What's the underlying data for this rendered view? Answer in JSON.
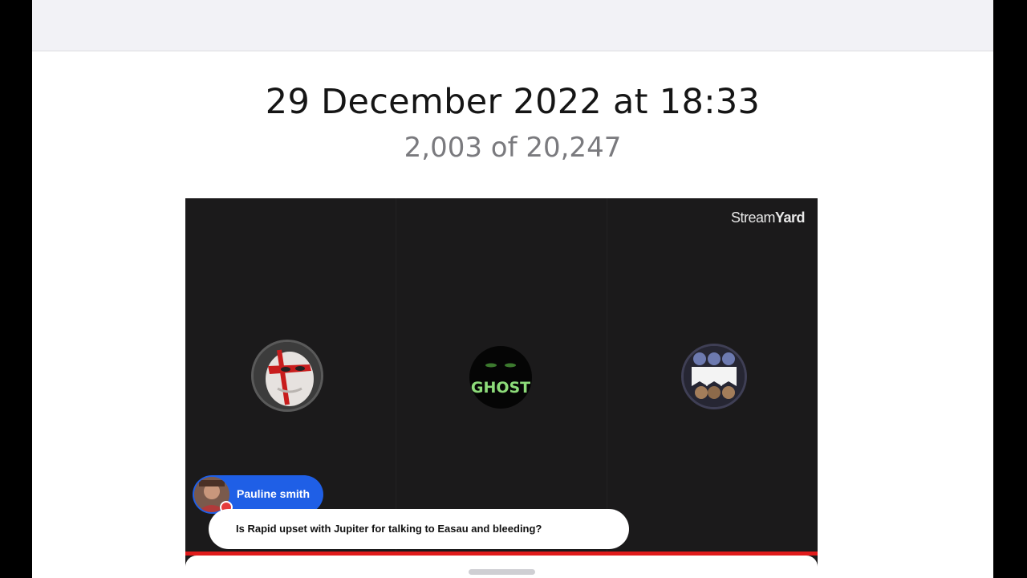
{
  "header": {
    "date": "29 December 2022 at 18:33",
    "counter": "2,003 of 20,247"
  },
  "video": {
    "watermark_light": "Stream",
    "watermark_bold": "Yard",
    "participants": [
      {
        "name": "masked-avatar-icon"
      },
      {
        "name": "ghost",
        "label": "GHOST"
      },
      {
        "name": "group-avatar-icon"
      }
    ],
    "chat": {
      "author": "Pauline smith",
      "message": "Is Rapid upset with Jupiter for talking to Easau and bleeding?"
    }
  },
  "colors": {
    "accent_blue": "#1f5fe6",
    "live_red": "#e01b1b",
    "video_bg": "#1b1a1b"
  }
}
